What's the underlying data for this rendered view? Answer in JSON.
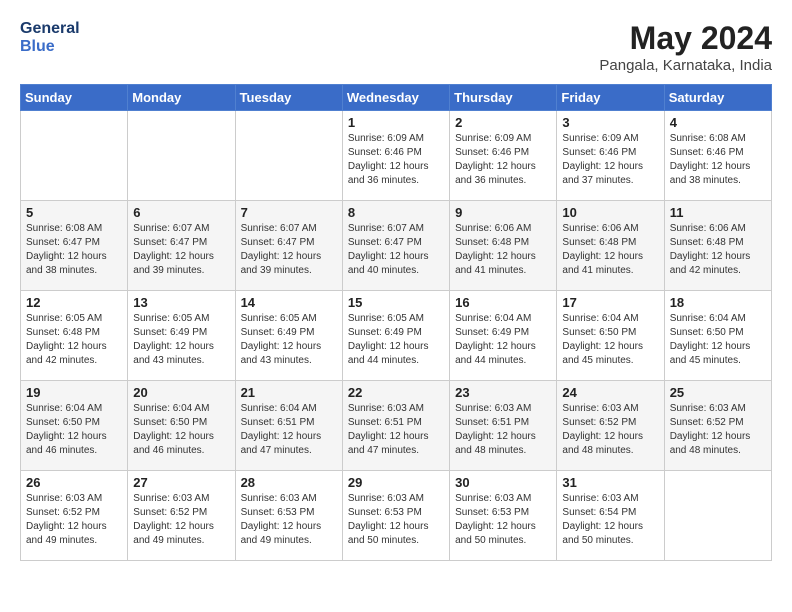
{
  "header": {
    "logo_general": "General",
    "logo_blue": "Blue",
    "month_year": "May 2024",
    "location": "Pangala, Karnataka, India"
  },
  "weekdays": [
    "Sunday",
    "Monday",
    "Tuesday",
    "Wednesday",
    "Thursday",
    "Friday",
    "Saturday"
  ],
  "weeks": [
    [
      {
        "day": "",
        "info": ""
      },
      {
        "day": "",
        "info": ""
      },
      {
        "day": "",
        "info": ""
      },
      {
        "day": "1",
        "info": "Sunrise: 6:09 AM\nSunset: 6:46 PM\nDaylight: 12 hours\nand 36 minutes."
      },
      {
        "day": "2",
        "info": "Sunrise: 6:09 AM\nSunset: 6:46 PM\nDaylight: 12 hours\nand 36 minutes."
      },
      {
        "day": "3",
        "info": "Sunrise: 6:09 AM\nSunset: 6:46 PM\nDaylight: 12 hours\nand 37 minutes."
      },
      {
        "day": "4",
        "info": "Sunrise: 6:08 AM\nSunset: 6:46 PM\nDaylight: 12 hours\nand 38 minutes."
      }
    ],
    [
      {
        "day": "5",
        "info": "Sunrise: 6:08 AM\nSunset: 6:47 PM\nDaylight: 12 hours\nand 38 minutes."
      },
      {
        "day": "6",
        "info": "Sunrise: 6:07 AM\nSunset: 6:47 PM\nDaylight: 12 hours\nand 39 minutes."
      },
      {
        "day": "7",
        "info": "Sunrise: 6:07 AM\nSunset: 6:47 PM\nDaylight: 12 hours\nand 39 minutes."
      },
      {
        "day": "8",
        "info": "Sunrise: 6:07 AM\nSunset: 6:47 PM\nDaylight: 12 hours\nand 40 minutes."
      },
      {
        "day": "9",
        "info": "Sunrise: 6:06 AM\nSunset: 6:48 PM\nDaylight: 12 hours\nand 41 minutes."
      },
      {
        "day": "10",
        "info": "Sunrise: 6:06 AM\nSunset: 6:48 PM\nDaylight: 12 hours\nand 41 minutes."
      },
      {
        "day": "11",
        "info": "Sunrise: 6:06 AM\nSunset: 6:48 PM\nDaylight: 12 hours\nand 42 minutes."
      }
    ],
    [
      {
        "day": "12",
        "info": "Sunrise: 6:05 AM\nSunset: 6:48 PM\nDaylight: 12 hours\nand 42 minutes."
      },
      {
        "day": "13",
        "info": "Sunrise: 6:05 AM\nSunset: 6:49 PM\nDaylight: 12 hours\nand 43 minutes."
      },
      {
        "day": "14",
        "info": "Sunrise: 6:05 AM\nSunset: 6:49 PM\nDaylight: 12 hours\nand 43 minutes."
      },
      {
        "day": "15",
        "info": "Sunrise: 6:05 AM\nSunset: 6:49 PM\nDaylight: 12 hours\nand 44 minutes."
      },
      {
        "day": "16",
        "info": "Sunrise: 6:04 AM\nSunset: 6:49 PM\nDaylight: 12 hours\nand 44 minutes."
      },
      {
        "day": "17",
        "info": "Sunrise: 6:04 AM\nSunset: 6:50 PM\nDaylight: 12 hours\nand 45 minutes."
      },
      {
        "day": "18",
        "info": "Sunrise: 6:04 AM\nSunset: 6:50 PM\nDaylight: 12 hours\nand 45 minutes."
      }
    ],
    [
      {
        "day": "19",
        "info": "Sunrise: 6:04 AM\nSunset: 6:50 PM\nDaylight: 12 hours\nand 46 minutes."
      },
      {
        "day": "20",
        "info": "Sunrise: 6:04 AM\nSunset: 6:50 PM\nDaylight: 12 hours\nand 46 minutes."
      },
      {
        "day": "21",
        "info": "Sunrise: 6:04 AM\nSunset: 6:51 PM\nDaylight: 12 hours\nand 47 minutes."
      },
      {
        "day": "22",
        "info": "Sunrise: 6:03 AM\nSunset: 6:51 PM\nDaylight: 12 hours\nand 47 minutes."
      },
      {
        "day": "23",
        "info": "Sunrise: 6:03 AM\nSunset: 6:51 PM\nDaylight: 12 hours\nand 48 minutes."
      },
      {
        "day": "24",
        "info": "Sunrise: 6:03 AM\nSunset: 6:52 PM\nDaylight: 12 hours\nand 48 minutes."
      },
      {
        "day": "25",
        "info": "Sunrise: 6:03 AM\nSunset: 6:52 PM\nDaylight: 12 hours\nand 48 minutes."
      }
    ],
    [
      {
        "day": "26",
        "info": "Sunrise: 6:03 AM\nSunset: 6:52 PM\nDaylight: 12 hours\nand 49 minutes."
      },
      {
        "day": "27",
        "info": "Sunrise: 6:03 AM\nSunset: 6:52 PM\nDaylight: 12 hours\nand 49 minutes."
      },
      {
        "day": "28",
        "info": "Sunrise: 6:03 AM\nSunset: 6:53 PM\nDaylight: 12 hours\nand 49 minutes."
      },
      {
        "day": "29",
        "info": "Sunrise: 6:03 AM\nSunset: 6:53 PM\nDaylight: 12 hours\nand 50 minutes."
      },
      {
        "day": "30",
        "info": "Sunrise: 6:03 AM\nSunset: 6:53 PM\nDaylight: 12 hours\nand 50 minutes."
      },
      {
        "day": "31",
        "info": "Sunrise: 6:03 AM\nSunset: 6:54 PM\nDaylight: 12 hours\nand 50 minutes."
      },
      {
        "day": "",
        "info": ""
      }
    ]
  ]
}
